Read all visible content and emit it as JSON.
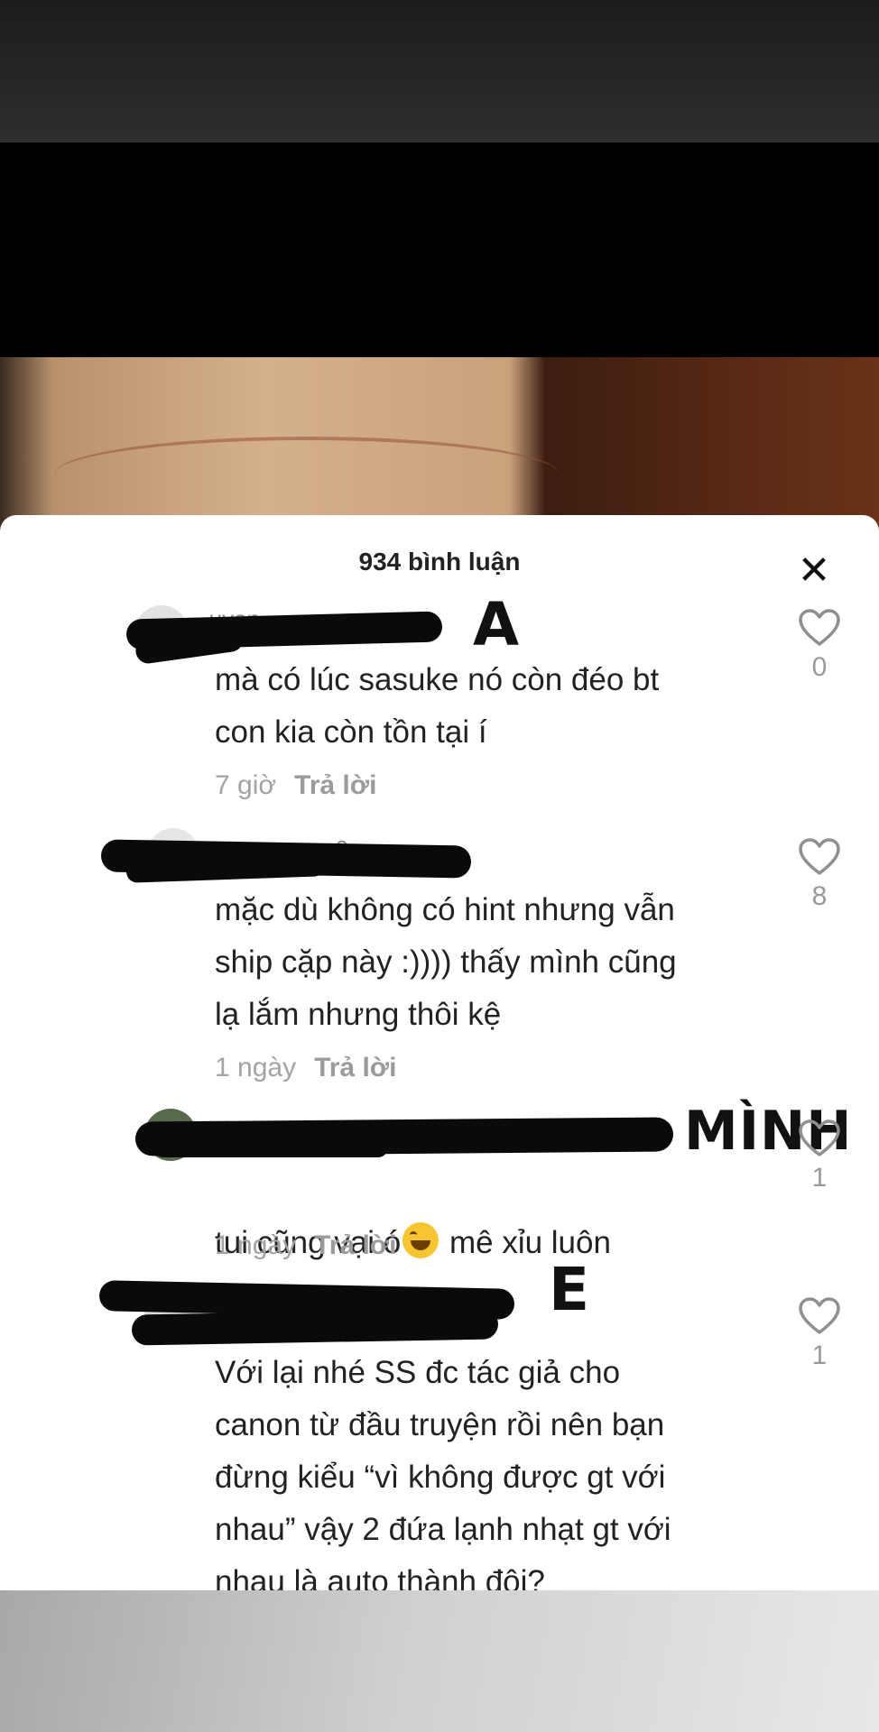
{
  "header": {
    "title": "934 bình luận",
    "close_icon": "close-icon"
  },
  "comments": [
    {
      "username": "...uyen",
      "annotation": "A",
      "text": "mà có lúc sasuke nó còn đéo bt\ncon kia còn tồn tại í",
      "time": "7 giờ",
      "reply": "Trả lời",
      "likes": "0"
    },
    {
      "username": "...0arg",
      "annotation": "",
      "text": "mặc dù không có hint nhưng vẫn\nship cặp này :)))) thấy mình cũng\nlạ lắm nhưng thôi kệ",
      "time": "1 ngày",
      "reply": "Trả lời",
      "likes": "8"
    },
    {
      "username": "",
      "annotation": "MÌNH",
      "text_before": "tui cũng vại ó",
      "text_after": " mê xỉu luôn",
      "emoji": "laughing-tears-emoji",
      "time": "1 ngày",
      "reply": "Trả lời",
      "likes": "1"
    },
    {
      "username": "",
      "annotation": "E",
      "text": "Với lại nhé SS đc tác giả cho\ncanon từ đầu truyện rồi nên bạn\nđừng kiểu “vì không được gt với\nnhau” vậy 2 đứa lạnh nhạt gt với\nnhau là auto thành đôi?",
      "time": "",
      "reply": "",
      "likes": "1"
    }
  ],
  "colors": {
    "panel": "#ffffff",
    "text": "#222222",
    "meta": "#a3a3a3",
    "redaction": "#0a0a0a"
  }
}
